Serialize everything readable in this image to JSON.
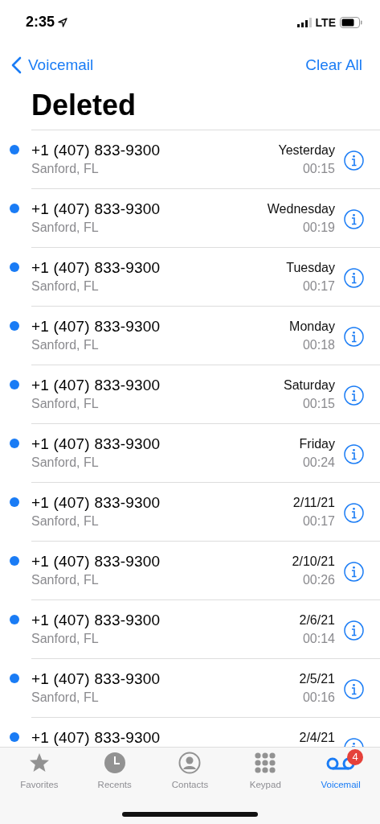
{
  "status_bar": {
    "time": "2:35",
    "network": "LTE"
  },
  "nav": {
    "back": "Voicemail",
    "action": "Clear All"
  },
  "title": "Deleted",
  "voicemails": [
    {
      "number": "+1 (407) 833-9300",
      "location": "Sanford, FL",
      "date": "Yesterday",
      "duration": "00:15",
      "unread": true
    },
    {
      "number": "+1 (407) 833-9300",
      "location": "Sanford, FL",
      "date": "Wednesday",
      "duration": "00:19",
      "unread": true
    },
    {
      "number": "+1 (407) 833-9300",
      "location": "Sanford, FL",
      "date": "Tuesday",
      "duration": "00:17",
      "unread": true
    },
    {
      "number": "+1 (407) 833-9300",
      "location": "Sanford, FL",
      "date": "Monday",
      "duration": "00:18",
      "unread": true
    },
    {
      "number": "+1 (407) 833-9300",
      "location": "Sanford, FL",
      "date": "Saturday",
      "duration": "00:15",
      "unread": true
    },
    {
      "number": "+1 (407) 833-9300",
      "location": "Sanford, FL",
      "date": "Friday",
      "duration": "00:24",
      "unread": true
    },
    {
      "number": "+1 (407) 833-9300",
      "location": "Sanford, FL",
      "date": "2/11/21",
      "duration": "00:17",
      "unread": true
    },
    {
      "number": "+1 (407) 833-9300",
      "location": "Sanford, FL",
      "date": "2/10/21",
      "duration": "00:26",
      "unread": true
    },
    {
      "number": "+1 (407) 833-9300",
      "location": "Sanford, FL",
      "date": "2/6/21",
      "duration": "00:14",
      "unread": true
    },
    {
      "number": "+1 (407) 833-9300",
      "location": "Sanford, FL",
      "date": "2/5/21",
      "duration": "00:16",
      "unread": true
    },
    {
      "number": "+1 (407) 833-9300",
      "date": "2/4/21",
      "unread": true
    }
  ],
  "tabs": [
    {
      "kind": "favorites",
      "label": "Favorites",
      "selected": false
    },
    {
      "kind": "recents",
      "label": "Recents",
      "selected": false
    },
    {
      "kind": "contacts",
      "label": "Contacts",
      "selected": false
    },
    {
      "kind": "keypad",
      "label": "Keypad",
      "selected": false
    },
    {
      "kind": "voicemail",
      "label": "Voicemail",
      "selected": true,
      "badge": "4"
    }
  ]
}
